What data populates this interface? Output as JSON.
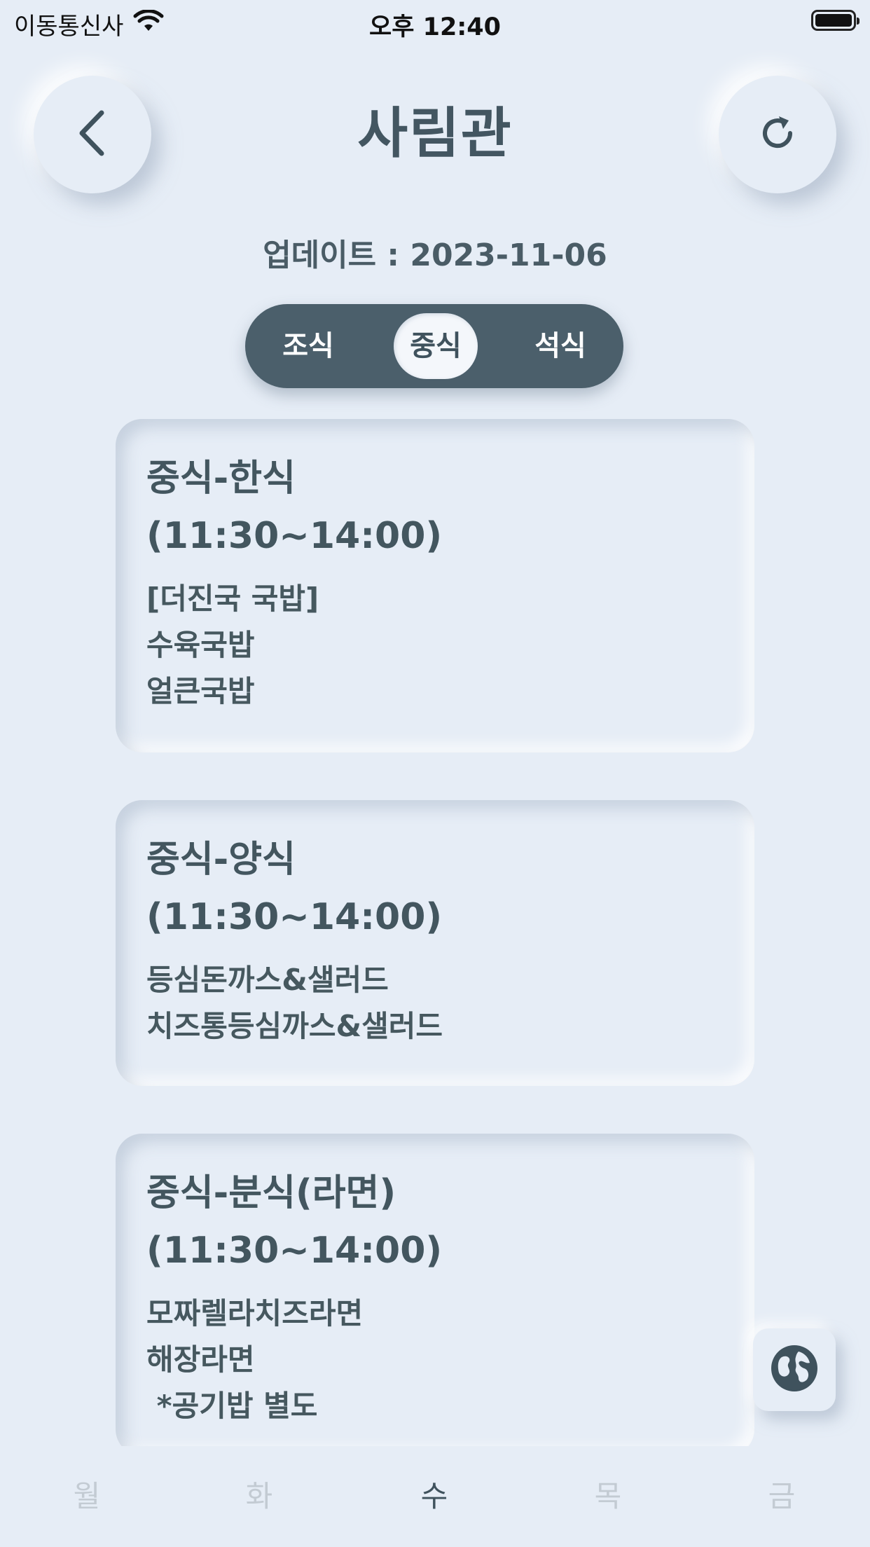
{
  "status": {
    "carrier": "이동통신사",
    "time": "오후 12:40"
  },
  "header": {
    "title": "사림관"
  },
  "update": {
    "text": "업데이트 : 2023-11-06"
  },
  "meal_tabs": [
    {
      "label": "조식",
      "active": false
    },
    {
      "label": "중식",
      "active": true
    },
    {
      "label": "석식",
      "active": false
    }
  ],
  "cards": [
    {
      "title": "중식-한식\n(11:30~14:00)",
      "items": [
        "[더진국 국밥]",
        "수육국밥",
        "얼큰국밥"
      ]
    },
    {
      "title": "중식-양식\n(11:30~14:00)",
      "items": [
        "등심돈까스&샐러드",
        "치즈통등심까스&샐러드"
      ]
    },
    {
      "title": "중식-분식(라면)\n(11:30~14:00)",
      "items": [
        "모짜렐라치즈라면",
        "해장라면",
        " *공기밥 별도"
      ]
    }
  ],
  "day_tabs": [
    {
      "label": "월",
      "active": false
    },
    {
      "label": "화",
      "active": false
    },
    {
      "label": "수",
      "active": true
    },
    {
      "label": "목",
      "active": false
    },
    {
      "label": "금",
      "active": false
    }
  ],
  "icons": {
    "back": "chevron-left-icon",
    "refresh": "refresh-icon",
    "globe": "globe-icon",
    "wifi": "wifi-icon",
    "battery": "battery-icon"
  },
  "colors": {
    "background": "#e6edf6",
    "segment": "#4b5f6b",
    "text": "#3f525d",
    "inactive_tab": "#c3cbd3"
  }
}
